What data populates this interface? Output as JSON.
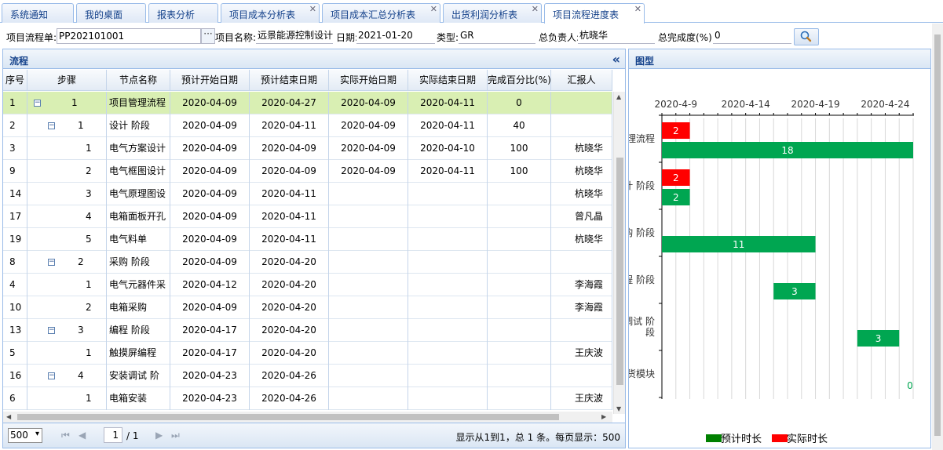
{
  "tabs": [
    {
      "label": "系统通知",
      "closable": false,
      "active": false
    },
    {
      "label": "我的桌面",
      "closable": false,
      "active": false
    },
    {
      "label": "报表分析",
      "closable": false,
      "active": false
    },
    {
      "label": "项目成本分析表",
      "closable": true,
      "active": false
    },
    {
      "label": "项目成本汇总分析表",
      "closable": true,
      "active": false
    },
    {
      "label": "出货利润分析表",
      "closable": true,
      "active": false
    },
    {
      "label": "项目流程进度表",
      "closable": true,
      "active": true
    }
  ],
  "tab_close_glyph": "✕",
  "form": {
    "flow_no_label": "项目流程单:",
    "flow_no_value": "PP202101001",
    "lookup_glyph": "···",
    "project_name_label": "项目名称:",
    "project_name_value": "远景能源控制设计",
    "date_label": "日期:",
    "date_value": "2021-01-20",
    "type_label": "类型:",
    "type_value": "GR",
    "owner_label": "总负责人:",
    "owner_value": "杭晓华",
    "completion_label": "总完成度(%):",
    "completion_value": "0",
    "search_icon": "search-icon"
  },
  "left_panel": {
    "title": "流程",
    "collapse_glyph": "«",
    "columns": [
      "序号",
      "步骤",
      "节点名称",
      "预计开始日期",
      "预计结束日期",
      "实际开始日期",
      "实际结束日期",
      "完成百分比(%)",
      "汇报人"
    ],
    "rows": [
      {
        "seq": "1",
        "level": 0,
        "toggle": "⊟",
        "step": "1",
        "name": "项目管理流程",
        "plan_start": "2020-04-09",
        "plan_end": "2020-04-27",
        "act_start": "2020-04-09",
        "act_end": "2020-04-11",
        "percent": "0",
        "reporter": "",
        "selected": true
      },
      {
        "seq": "2",
        "level": 1,
        "toggle": "⊟",
        "step": "1",
        "name": "设计 阶段",
        "plan_start": "2020-04-09",
        "plan_end": "2020-04-11",
        "act_start": "2020-04-09",
        "act_end": "2020-04-11",
        "percent": "40",
        "reporter": "",
        "selected": false
      },
      {
        "seq": "3",
        "level": 2,
        "toggle": "",
        "step": "1",
        "name": "电气方案设计",
        "plan_start": "2020-04-09",
        "plan_end": "2020-04-09",
        "act_start": "2020-04-09",
        "act_end": "2020-04-10",
        "percent": "100",
        "reporter": "杭晓华",
        "selected": false
      },
      {
        "seq": "9",
        "level": 2,
        "toggle": "",
        "step": "2",
        "name": "电气框图设计",
        "plan_start": "2020-04-09",
        "plan_end": "2020-04-09",
        "act_start": "2020-04-09",
        "act_end": "2020-04-11",
        "percent": "100",
        "reporter": "杭晓华",
        "selected": false
      },
      {
        "seq": "14",
        "level": 2,
        "toggle": "",
        "step": "3",
        "name": "电气原理图设",
        "plan_start": "2020-04-09",
        "plan_end": "2020-04-11",
        "act_start": "",
        "act_end": "",
        "percent": "",
        "reporter": "杭晓华",
        "selected": false
      },
      {
        "seq": "17",
        "level": 2,
        "toggle": "",
        "step": "4",
        "name": "电箱面板开孔",
        "plan_start": "2020-04-09",
        "plan_end": "2020-04-11",
        "act_start": "",
        "act_end": "",
        "percent": "",
        "reporter": "曾凡晶",
        "selected": false
      },
      {
        "seq": "19",
        "level": 2,
        "toggle": "",
        "step": "5",
        "name": "电气料单",
        "plan_start": "2020-04-09",
        "plan_end": "2020-04-11",
        "act_start": "",
        "act_end": "",
        "percent": "",
        "reporter": "杭晓华",
        "selected": false
      },
      {
        "seq": "8",
        "level": 1,
        "toggle": "⊟",
        "step": "2",
        "name": "采购 阶段",
        "plan_start": "2020-04-09",
        "plan_end": "2020-04-20",
        "act_start": "",
        "act_end": "",
        "percent": "",
        "reporter": "",
        "selected": false
      },
      {
        "seq": "4",
        "level": 2,
        "toggle": "",
        "step": "1",
        "name": "电气元器件采",
        "plan_start": "2020-04-12",
        "plan_end": "2020-04-20",
        "act_start": "",
        "act_end": "",
        "percent": "",
        "reporter": "李海霞",
        "selected": false
      },
      {
        "seq": "10",
        "level": 2,
        "toggle": "",
        "step": "2",
        "name": "电箱采购",
        "plan_start": "2020-04-09",
        "plan_end": "2020-04-20",
        "act_start": "",
        "act_end": "",
        "percent": "",
        "reporter": "李海霞",
        "selected": false
      },
      {
        "seq": "13",
        "level": 1,
        "toggle": "⊟",
        "step": "3",
        "name": "编程 阶段",
        "plan_start": "2020-04-17",
        "plan_end": "2020-04-20",
        "act_start": "",
        "act_end": "",
        "percent": "",
        "reporter": "",
        "selected": false
      },
      {
        "seq": "5",
        "level": 2,
        "toggle": "",
        "step": "1",
        "name": "触摸屏编程",
        "plan_start": "2020-04-17",
        "plan_end": "2020-04-20",
        "act_start": "",
        "act_end": "",
        "percent": "",
        "reporter": "王庆波",
        "selected": false
      },
      {
        "seq": "16",
        "level": 1,
        "toggle": "⊟",
        "step": "4",
        "name": "安装调试 阶",
        "plan_start": "2020-04-23",
        "plan_end": "2020-04-26",
        "act_start": "",
        "act_end": "",
        "percent": "",
        "reporter": "",
        "selected": false
      },
      {
        "seq": "6",
        "level": 2,
        "toggle": "",
        "step": "1",
        "name": "电箱安装",
        "plan_start": "2020-04-23",
        "plan_end": "2020-04-26",
        "act_start": "",
        "act_end": "",
        "percent": "",
        "reporter": "王庆波",
        "selected": false
      }
    ],
    "pager": {
      "page_size": "500",
      "first_glyph": "⏮",
      "prev_glyph": "◀",
      "page": "1",
      "total_pages": "/ 1",
      "next_glyph": "▶",
      "last_glyph": "⏭",
      "info": "显示从1到1，总 1 条。每页显示：500"
    }
  },
  "right_panel": {
    "title": "图型"
  },
  "chart_data": {
    "type": "bar",
    "orientation": "horizontal",
    "x_ticks": [
      "2020-4-9",
      "2020-4-14",
      "2020-4-19",
      "2020-4-24"
    ],
    "x_tick_days": [
      9,
      14,
      19,
      24
    ],
    "x_range_days": [
      8,
      26
    ],
    "categories": [
      "理流程",
      "计 阶段",
      "购 阶段",
      "程 阶段",
      "调试 阶段",
      "货模块"
    ],
    "category_label_lines": [
      [
        "理流程"
      ],
      [
        "计 阶段"
      ],
      [
        "购 阶段"
      ],
      [
        "程 阶段"
      ],
      [
        "调试 阶",
        "段"
      ],
      [
        "货模块"
      ]
    ],
    "series": [
      {
        "name": "实际时长",
        "color": "#ff0000",
        "bars": [
          {
            "cat": 0,
            "start": 8,
            "value": 2
          },
          {
            "cat": 1,
            "start": 8,
            "value": 2
          }
        ]
      },
      {
        "name": "预计时长",
        "color": "#00a651",
        "bars": [
          {
            "cat": 0,
            "start": 8,
            "value": 18
          },
          {
            "cat": 1,
            "start": 8,
            "value": 2
          },
          {
            "cat": 2,
            "start": 8,
            "value": 11
          },
          {
            "cat": 3,
            "start": 16,
            "value": 3
          },
          {
            "cat": 4,
            "start": 22,
            "value": 3
          },
          {
            "cat": 5,
            "start": 26,
            "value": 0
          }
        ]
      }
    ],
    "legend": [
      {
        "name": "预计时长",
        "color": "#008000"
      },
      {
        "name": "实际时长",
        "color": "#ff0000"
      }
    ],
    "legend_position": "bottom",
    "grid": true
  }
}
